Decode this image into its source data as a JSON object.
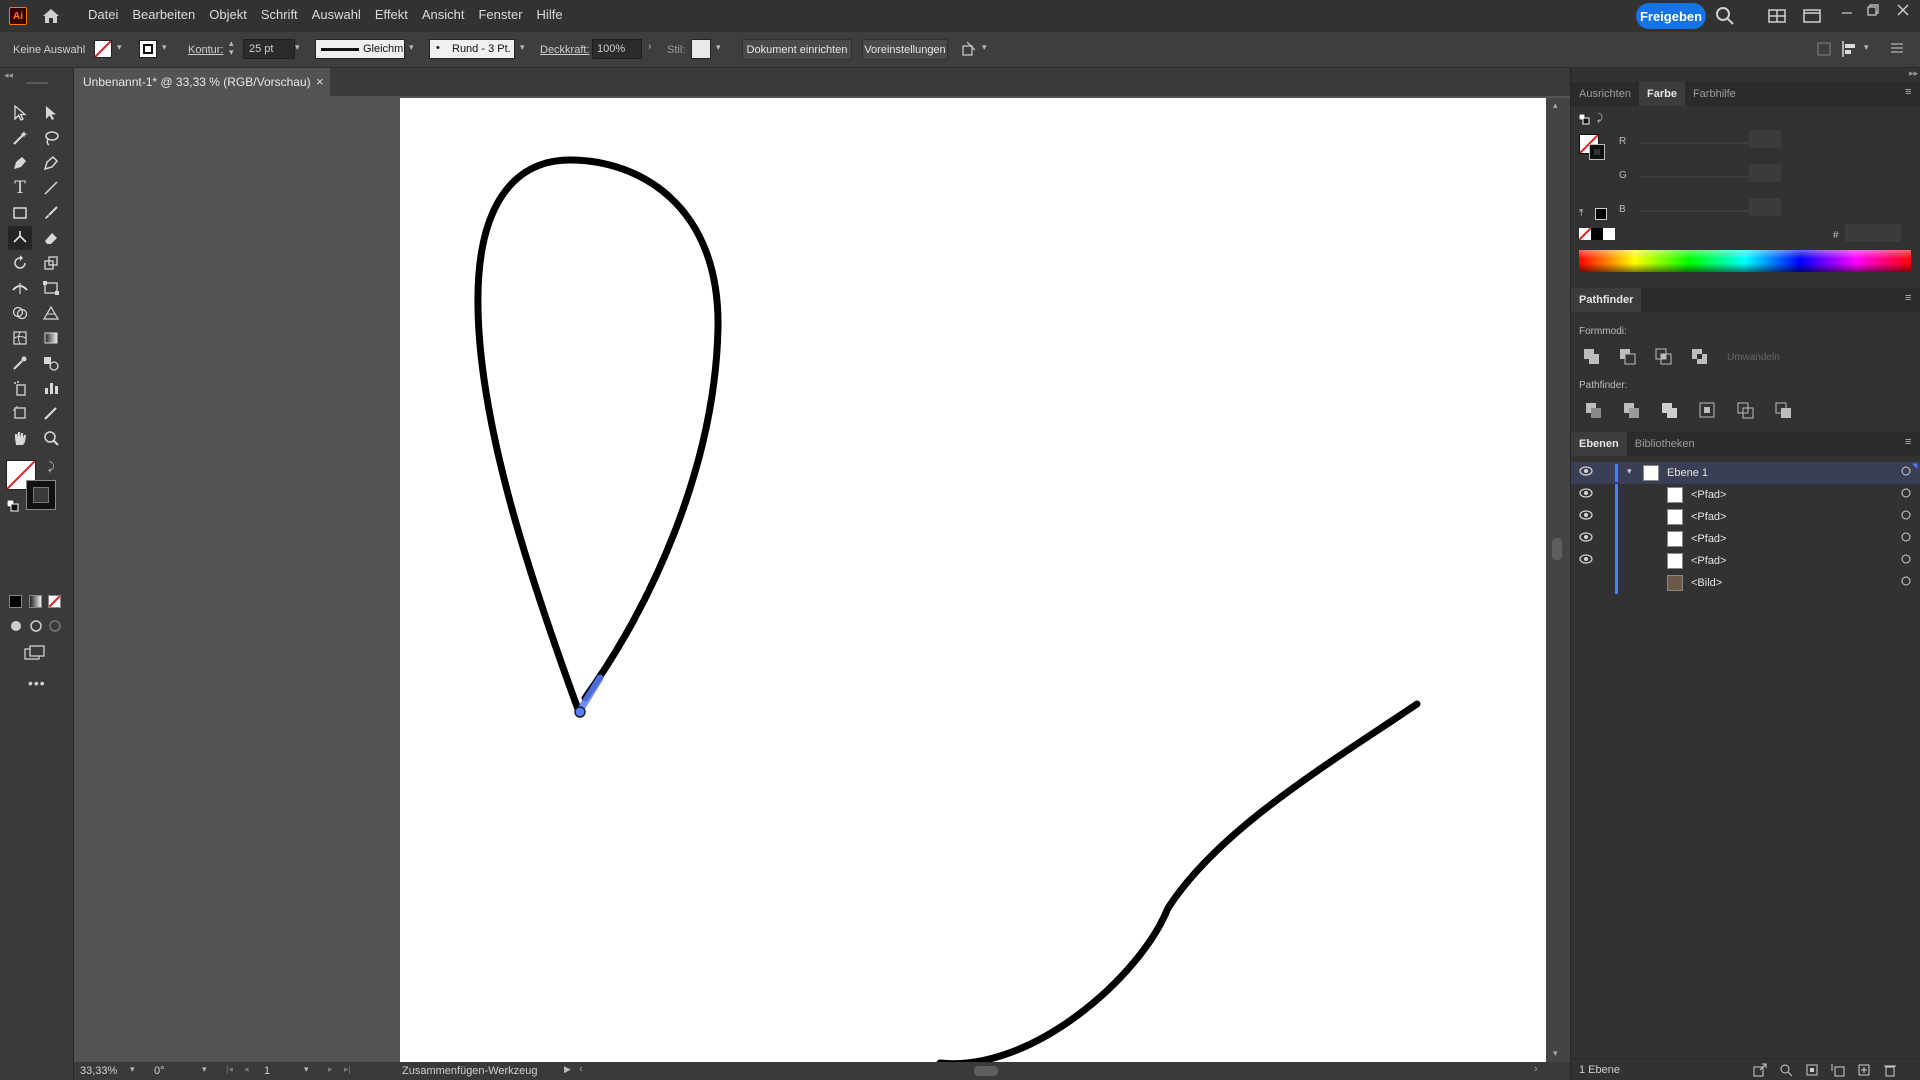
{
  "app": {
    "logo": "Ai"
  },
  "menu": {
    "items": [
      "Datei",
      "Bearbeiten",
      "Objekt",
      "Schrift",
      "Auswahl",
      "Effekt",
      "Ansicht",
      "Fenster",
      "Hilfe"
    ],
    "share_label": "Freigeben"
  },
  "control": {
    "selection": "Keine Auswahl",
    "stroke_label": "Kontur:",
    "stroke_weight": "25 pt",
    "profile": "Gleichm.",
    "brush": "Rund - 3 Pt.",
    "opacity_label": "Deckkraft:",
    "opacity": "100%",
    "style_label": "Stil:",
    "doc_setup": "Dokument einrichten",
    "preferences": "Voreinstellungen"
  },
  "document": {
    "tab_title": "Unbenannt-1* @ 33,33 % (RGB/Vorschau)",
    "close": "×"
  },
  "status": {
    "zoom": "33,33%",
    "rotation": "0°",
    "artboard": "1",
    "tool_name": "Zusammenfügen-Werkzeug"
  },
  "color_panel": {
    "tabs": [
      "Ausrichten",
      "Farbe",
      "Farbhilfe"
    ],
    "channels": [
      "R",
      "G",
      "B"
    ],
    "hex_symbol": "#"
  },
  "pathfinder": {
    "title": "Pathfinder",
    "shape_modes_label": "Formmodi:",
    "expand_label": "Umwandeln",
    "pathfinders_label": "Pathfinder:"
  },
  "layers": {
    "tabs": [
      "Ebenen",
      "Bibliotheken"
    ],
    "rows": [
      {
        "name": "Ebene 1",
        "indent": 0
      },
      {
        "name": "<Pfad>",
        "indent": 1
      },
      {
        "name": "<Pfad>",
        "indent": 1
      },
      {
        "name": "<Pfad>",
        "indent": 1
      },
      {
        "name": "<Pfad>",
        "indent": 1
      },
      {
        "name": "<Bild>",
        "indent": 1
      }
    ],
    "footer": "1 Ebene"
  },
  "colors": {
    "accent": "#1473e6",
    "layer_color": "#4f7bff",
    "selection_highlight": "#5b7dff"
  }
}
